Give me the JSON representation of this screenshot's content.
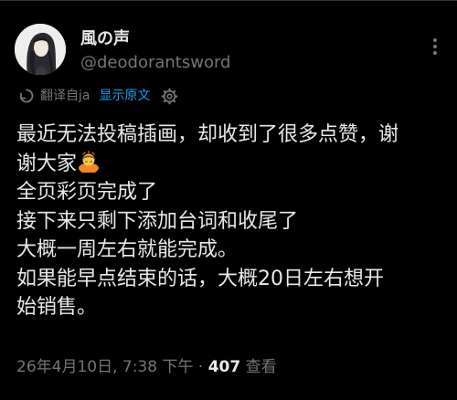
{
  "author": {
    "display_name": "風の声",
    "handle": "@deodorantsword"
  },
  "translation": {
    "translated_from": "翻译自ja",
    "show_original": "显示原文"
  },
  "tweet": {
    "lines": [
      "最近无法投稿插画，却收到了很多点赞，谢",
      "谢大家",
      "全页彩页完成了",
      "接下来只剩下添加台词和收尾了",
      "大概一周左右就能完成。",
      "如果能早点结束的话，大概20日左右想开",
      "始销售。"
    ],
    "emoji": "bowing-person-emoji"
  },
  "meta": {
    "timestamp": "26年4月10日, 7:38 下午",
    "separator": " · ",
    "views_count": "407",
    "views_label": " 查看"
  },
  "icons": {
    "more": "more-options-icon",
    "translate": "translate-icon",
    "settings": "gear-icon"
  },
  "colors": {
    "background": "#000000",
    "text": "#e7e9ea",
    "secondary": "#71767b",
    "link": "#1d9bf0"
  }
}
